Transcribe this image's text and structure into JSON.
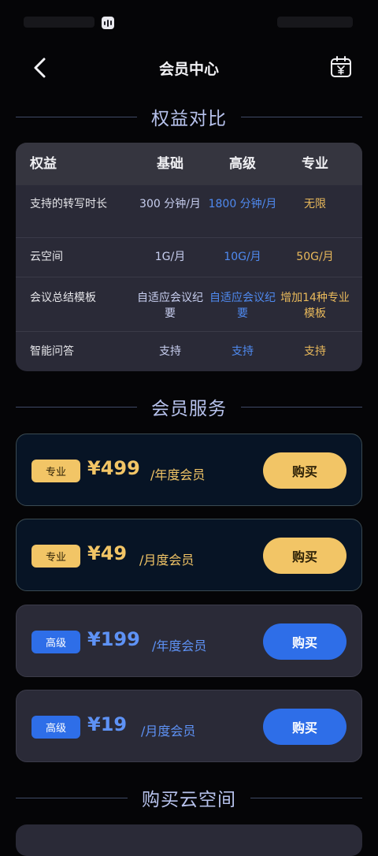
{
  "header": {
    "title": "会员中心"
  },
  "sections": {
    "compare": "权益对比",
    "service": "会员服务",
    "cloud": "购买云空间"
  },
  "table": {
    "headers": [
      "权益",
      "基础",
      "高级",
      "专业"
    ],
    "rows": [
      [
        "支持的转写时长",
        "300 分钟/月",
        "1800 分钟/月",
        "无限"
      ],
      [
        "云空间",
        "1G/月",
        "10G/月",
        "50G/月"
      ],
      [
        "会议总结模板",
        "自适应会议纪要",
        "自适应会议纪要",
        "增加14种专业模板"
      ],
      [
        "智能问答",
        "支持",
        "支持",
        "支持"
      ]
    ]
  },
  "plans": [
    {
      "tier": "专业",
      "price": "¥499",
      "period": "/年度会员",
      "buy": "购买"
    },
    {
      "tier": "专业",
      "price": "¥49",
      "period": "/月度会员",
      "buy": "购买"
    },
    {
      "tier": "高级",
      "price": "¥199",
      "period": "/年度会员",
      "buy": "购买"
    },
    {
      "tier": "高级",
      "price": "¥19",
      "period": "/月度会员",
      "buy": "购买"
    }
  ],
  "colors": {
    "gold": "#f2c566",
    "blue": "#2e6ee8",
    "accent_text": "#b7c2ec"
  },
  "icons": {
    "back": "chevron-left-icon",
    "calendar": "calendar-yuan-icon"
  }
}
